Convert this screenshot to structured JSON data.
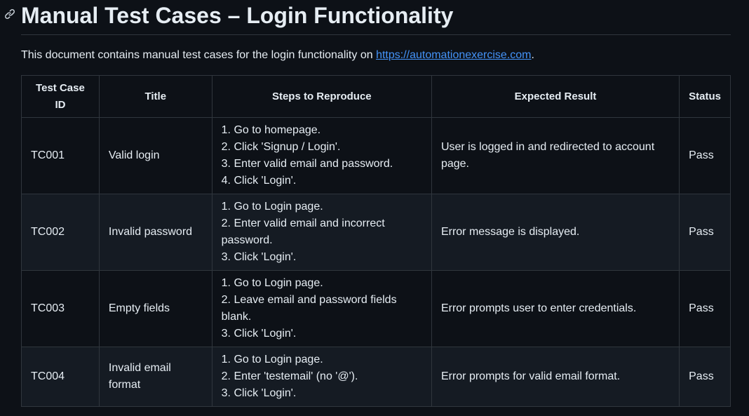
{
  "page": {
    "title": "Manual Test Cases – Login Functionality",
    "intro_text": "This document contains manual test cases for the login functionality on ",
    "intro_link": "https://automationexercise.com",
    "intro_end": "."
  },
  "table": {
    "headers": {
      "id": "Test Case ID",
      "title": "Title",
      "steps": "Steps to Reproduce",
      "expected": "Expected Result",
      "status": "Status"
    },
    "rows": [
      {
        "id": "TC001",
        "title": "Valid login",
        "steps": "1. Go to homepage.\n2. Click 'Signup / Login'.\n3. Enter valid email and password.\n4. Click 'Login'.",
        "expected": "User is logged in and redirected to account page.",
        "status": "Pass"
      },
      {
        "id": "TC002",
        "title": "Invalid password",
        "steps": "1. Go to Login page.\n2. Enter valid email and incorrect password.\n3. Click 'Login'.",
        "expected": "Error message is displayed.",
        "status": "Pass"
      },
      {
        "id": "TC003",
        "title": "Empty fields",
        "steps": "1. Go to Login page.\n2. Leave email and password fields blank.\n3. Click 'Login'.",
        "expected": "Error prompts user to enter credentials.",
        "status": "Pass"
      },
      {
        "id": "TC004",
        "title": "Invalid email format",
        "steps": "1. Go to Login page.\n2. Enter 'testemail' (no '@').\n3. Click 'Login'.",
        "expected": "Error prompts for valid email format.",
        "status": "Pass"
      }
    ]
  },
  "icons": {
    "heading_anchor": "link-icon"
  },
  "colors": {
    "background": "#0d1117",
    "text": "#e6edf3",
    "link": "#4493f8",
    "border": "#30363d",
    "row_alt": "#151b23"
  }
}
